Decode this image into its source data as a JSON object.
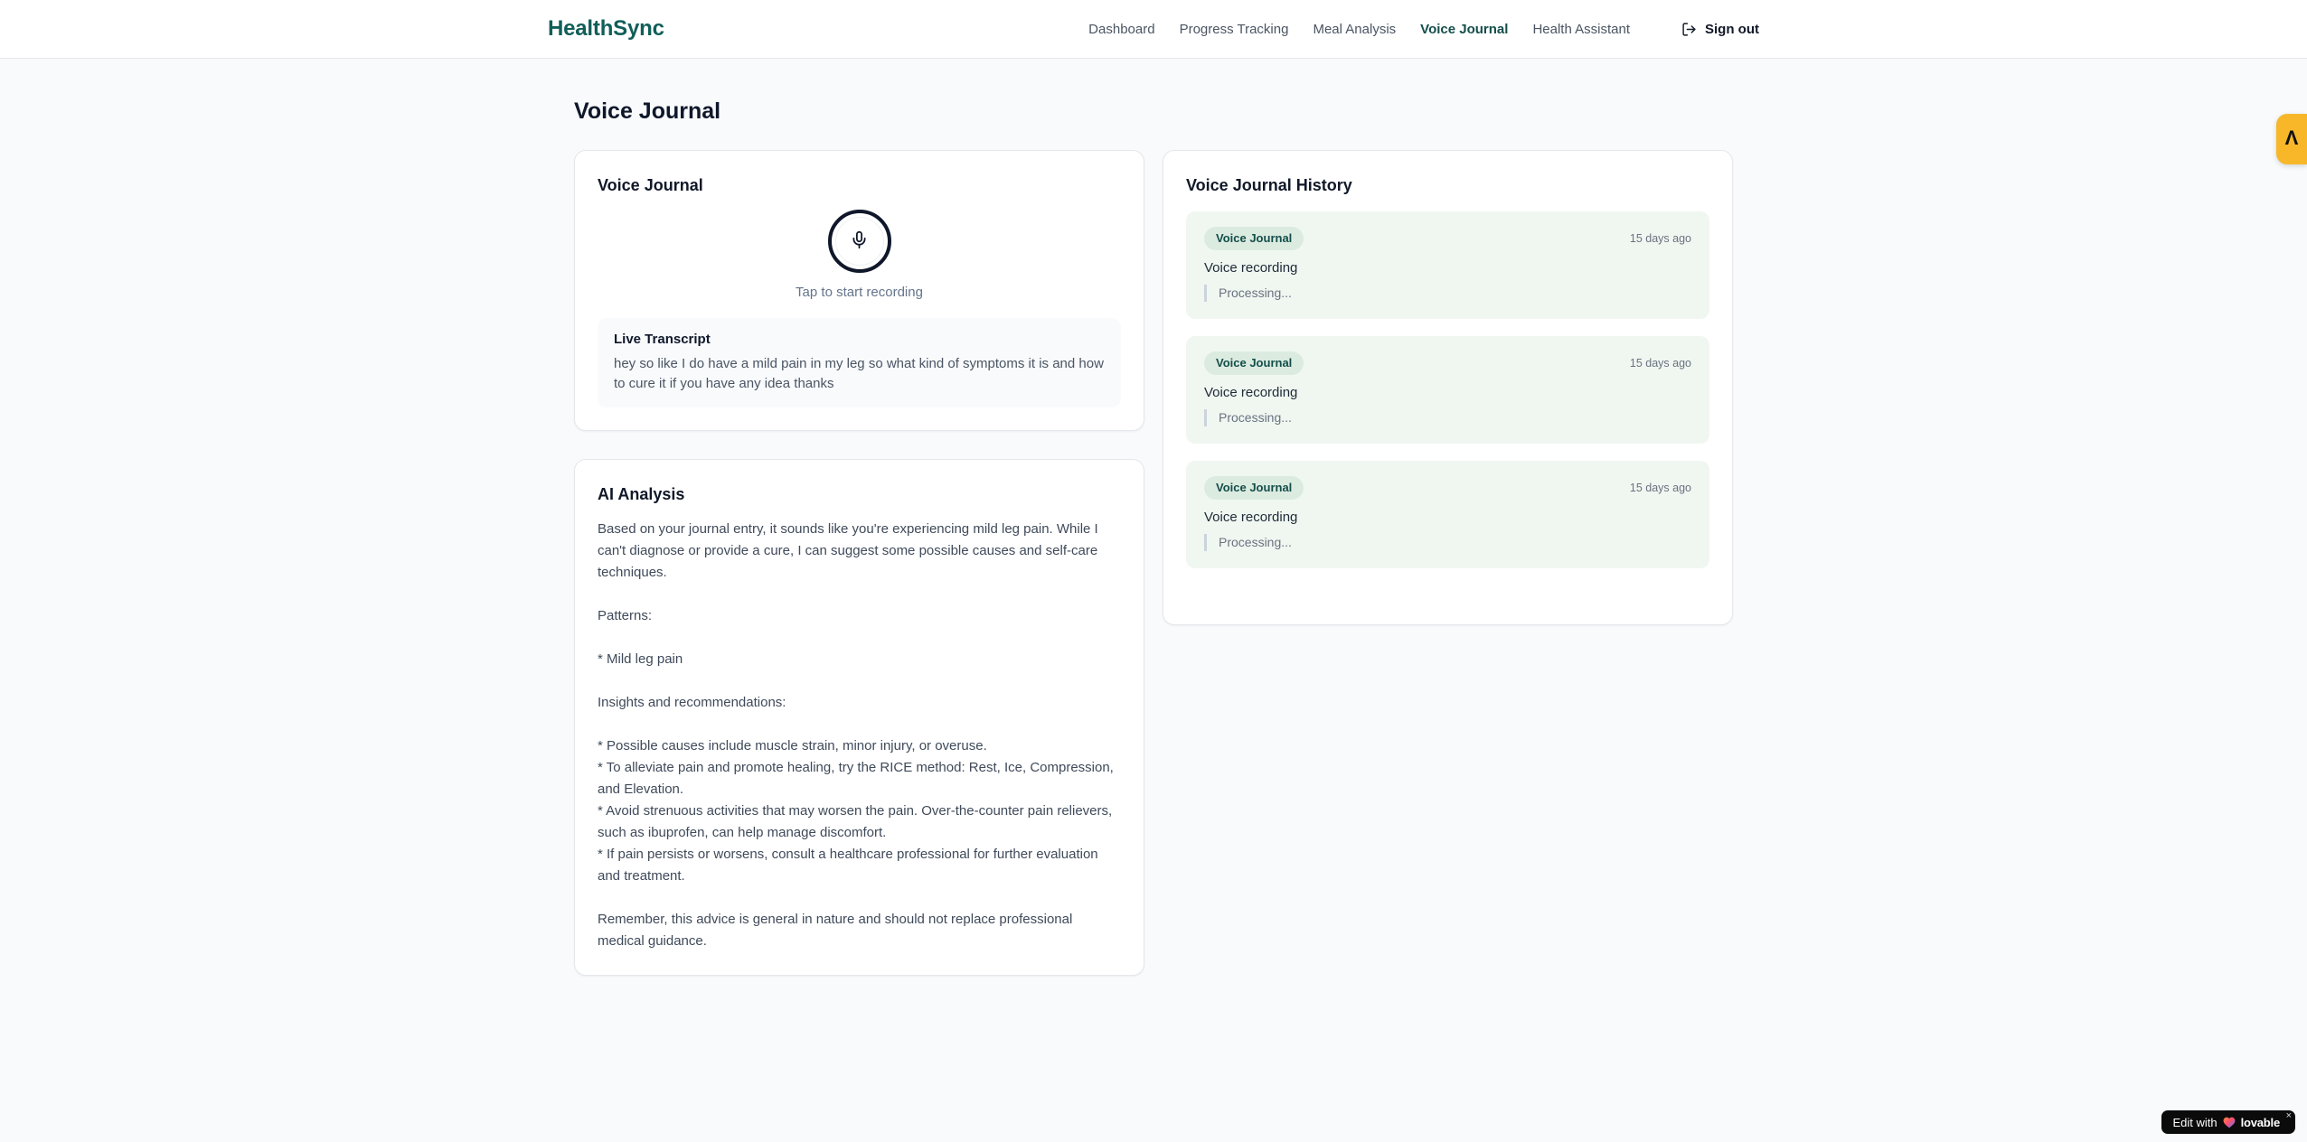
{
  "header": {
    "logo": "HealthSync",
    "nav": [
      {
        "label": "Dashboard",
        "active": false
      },
      {
        "label": "Progress Tracking",
        "active": false
      },
      {
        "label": "Meal Analysis",
        "active": false
      },
      {
        "label": "Voice Journal",
        "active": true
      },
      {
        "label": "Health Assistant",
        "active": false
      }
    ],
    "sign_out_label": "Sign out"
  },
  "page": {
    "title": "Voice Journal"
  },
  "recorder_card": {
    "title": "Voice Journal",
    "tap_hint": "Tap to start recording",
    "transcript_title": "Live Transcript",
    "transcript_text": "hey so like I do have a mild pain in my leg so what kind of symptoms it is and how to cure it if you have any idea thanks"
  },
  "analysis_card": {
    "title": "AI Analysis",
    "paragraphs": [
      "Based on your journal entry, it sounds like you're experiencing mild leg pain. While I can't diagnose or provide a cure, I can suggest some possible causes and self-care techniques.",
      "Patterns:",
      "* Mild leg pain",
      "Insights and recommendations:",
      "* Possible causes include muscle strain, minor injury, or overuse.\n* To alleviate pain and promote healing, try the RICE method: Rest, Ice, Compression, and Elevation.\n* Avoid strenuous activities that may worsen the pain. Over-the-counter pain relievers, such as ibuprofen, can help manage discomfort.\n* If pain persists or worsens, consult a healthcare professional for further evaluation and treatment.",
      "Remember, this advice is general in nature and should not replace professional medical guidance."
    ]
  },
  "history_card": {
    "title": "Voice Journal History",
    "entries": [
      {
        "badge": "Voice Journal",
        "time": "15 days ago",
        "label": "Voice recording",
        "status": "Processing..."
      },
      {
        "badge": "Voice Journal",
        "time": "15 days ago",
        "label": "Voice recording",
        "status": "Processing..."
      },
      {
        "badge": "Voice Journal",
        "time": "15 days ago",
        "label": "Voice recording",
        "status": "Processing..."
      }
    ]
  },
  "overlays": {
    "side_tab_glyph": "Λ",
    "lovable": {
      "prefix": "Edit with",
      "brand": "lovable",
      "close": "×"
    }
  },
  "icons": {
    "microphone-icon": "microphone outline",
    "logout-icon": "door with right arrow",
    "heart-icon": "gradient heart",
    "close-icon": "×"
  },
  "colors": {
    "brand_teal": "#115e59",
    "nav_active": "#134e4a",
    "accent_yellow": "#f7b729",
    "entry_bg": "#f0f7f1",
    "badge_bg": "#dcebe0",
    "badge_text": "#134e4a",
    "page_bg": "#f8fafc",
    "pill_bg": "#0b0b0c"
  }
}
